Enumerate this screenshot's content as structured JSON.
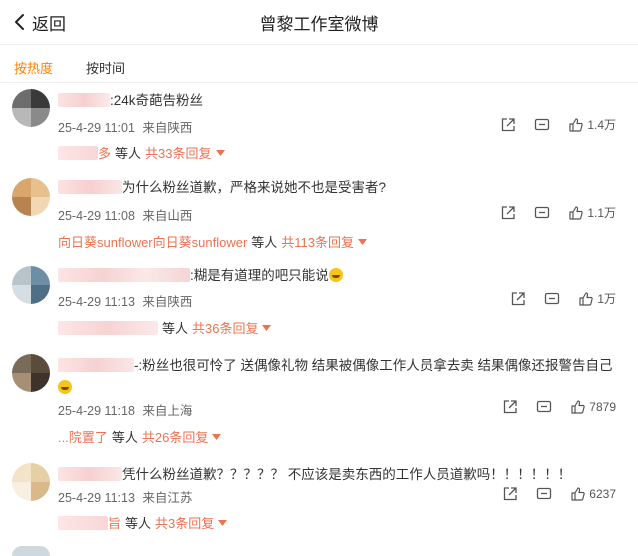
{
  "header": {
    "back_label": "返回",
    "title": "曾黎工作室微博"
  },
  "tabs": [
    {
      "label": "按热度",
      "active": true
    },
    {
      "label": "按时间",
      "active": false
    }
  ],
  "comments": [
    {
      "name_visible": "",
      "text": ":24k奇葩告粉丝",
      "time": "25-4-29 11:01",
      "location": "来自陕西",
      "likes": "1.4万",
      "reply_name": "",
      "reply_name_visible": "多",
      "reply_people": "等人",
      "reply_count": "共33条回复",
      "avatar_colors": [
        "#6d6d6d",
        "#3a3a3a",
        "#b8b8b8",
        "#8a8a8a"
      ]
    },
    {
      "name_visible": "",
      "text": "为什么粉丝道歉，严格来说她不也是受害者?",
      "time": "25-4-29 11:08",
      "location": "来自山西",
      "likes": "1.1万",
      "reply_name": "向日葵sunflower向日葵sunflower",
      "reply_people": "等人",
      "reply_count": "共113条回复",
      "avatar_colors": [
        "#d9a66b",
        "#e8c08e",
        "#b98350",
        "#f2d7b3"
      ]
    },
    {
      "name_visible": "",
      "text": ":糊是有道理的吧只能说",
      "time": "25-4-29 11:13",
      "location": "来自陕西",
      "likes": "1万",
      "reply_name": "",
      "reply_people": "等人",
      "reply_count": "共36条回复",
      "avatar_colors": [
        "#b8c4cc",
        "#6d8fa6",
        "#d7dee3",
        "#4e6f86"
      ]
    },
    {
      "name_visible": "",
      "text": "-:粉丝也很可怜了 送偶像礼物 结果被偶像工作人员拿去卖 结果偶像还报警告自己",
      "time": "25-4-29 11:18",
      "location": "来自上海",
      "likes": "7879",
      "reply_name": "...院置了",
      "reply_people": "等人",
      "reply_count": "共26条回复",
      "avatar_colors": [
        "#7a6a58",
        "#5a4b3c",
        "#a58f76",
        "#3d332a"
      ]
    },
    {
      "name_visible": "",
      "text": "凭什么粉丝道歉？？？？？ 不应该是卖东西的工作人员道歉吗！！！！！！",
      "time": "25-4-29 11:13",
      "location": "来自江苏",
      "likes": "6237",
      "reply_name": "",
      "reply_name_visible": "旨",
      "reply_people": "等人",
      "reply_count": "共3条回复",
      "avatar_colors": [
        "#f3e3c8",
        "#e6cfa5",
        "#f8efe0",
        "#d9b98a"
      ]
    }
  ],
  "colors": {
    "accent": "#ff8200",
    "reply_link": "#eb7350",
    "meta": "#666666"
  }
}
